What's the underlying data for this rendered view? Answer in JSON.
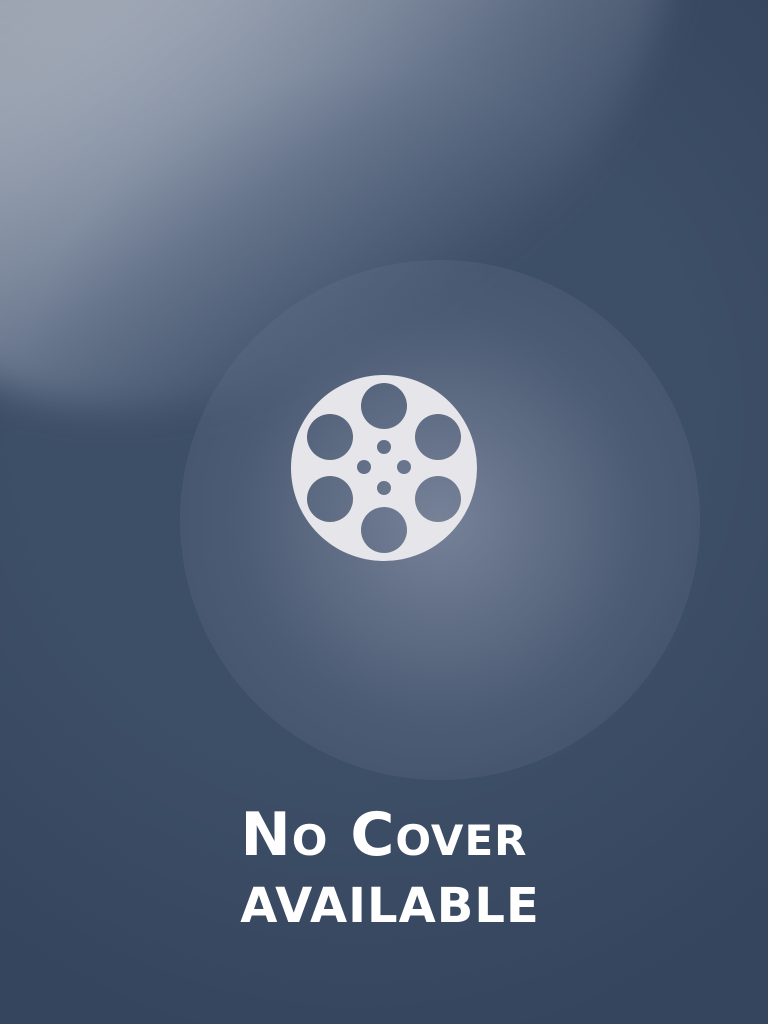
{
  "cover": {
    "icon": "film-reel-icon",
    "line1": "No Cover",
    "line2": "AVAILABLE",
    "colors": {
      "background": "#3d4e67",
      "text": "#ffffff",
      "reel": "#e6e6ea"
    }
  }
}
